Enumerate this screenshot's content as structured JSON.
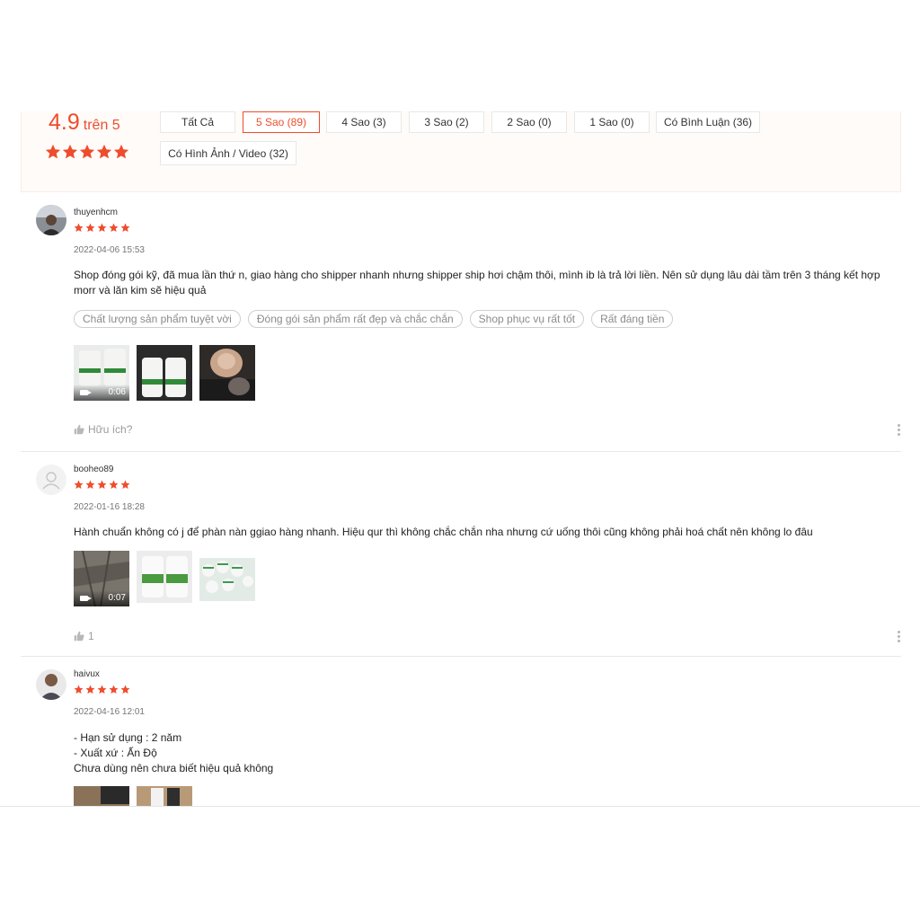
{
  "rating": {
    "score": "4.9",
    "suffix": "trên 5",
    "stars": 5
  },
  "filters": [
    {
      "label": "Tất Cả",
      "active": false
    },
    {
      "label": "5 Sao (89)",
      "active": true
    },
    {
      "label": "4 Sao (3)",
      "active": false
    },
    {
      "label": "3 Sao (2)",
      "active": false
    },
    {
      "label": "2 Sao (0)",
      "active": false
    },
    {
      "label": "1 Sao (0)",
      "active": false
    },
    {
      "label": "Có Bình Luận (36)",
      "active": false
    },
    {
      "label": "Có Hình Ảnh / Video (32)",
      "active": false
    }
  ],
  "reviews": [
    {
      "username": "thuyenhcm",
      "stars": 5,
      "date": "2022-04-06 15:53",
      "text": "Shop đóng gói kỹ, đã mua lần thứ n, giao hàng cho shipper nhanh nhưng shipper ship hơi chậm thôi, mình ib là trả lời liền. Nên sử dụng lâu dài tầm trên 3 tháng kết hợp morr và lăn kim sẽ hiệu quả",
      "tags": [
        "Chất lượng sản phẩm tuyệt vời",
        "Đóng gói sản phẩm rất đẹp và chắc chắn",
        "Shop phục vụ rất tốt",
        "Rất đáng tiền"
      ],
      "video_duration": "0:06",
      "helpful_label": "Hữu ích?"
    },
    {
      "username": "booheo89",
      "stars": 5,
      "date": "2022-01-16 18:28",
      "text": "Hành chuẩn không có j để phàn nàn ggiao hàng nhanh. Hiệu qur thì không chắc chắn nha nhưng cứ uống thôi cũng không phải hoá chất nên không lo đâu",
      "video_duration": "0:07",
      "helpful_label": "1"
    },
    {
      "username": "haivux",
      "stars": 5,
      "date": "2022-04-16 12:01",
      "text_lines": [
        "- Hạn sử dụng : 2 năm",
        "- Xuất xứ : Ấn Độ",
        "Chưa dùng nên chưa biết hiệu quả không"
      ]
    }
  ],
  "colors": {
    "accent": "#ee4d2d",
    "star": "#ee4d2d",
    "muted": "#757575"
  },
  "icons": [
    "star-icon",
    "thumbs-up-icon",
    "more-vertical-icon",
    "video-camera-icon",
    "default-avatar-icon"
  ]
}
